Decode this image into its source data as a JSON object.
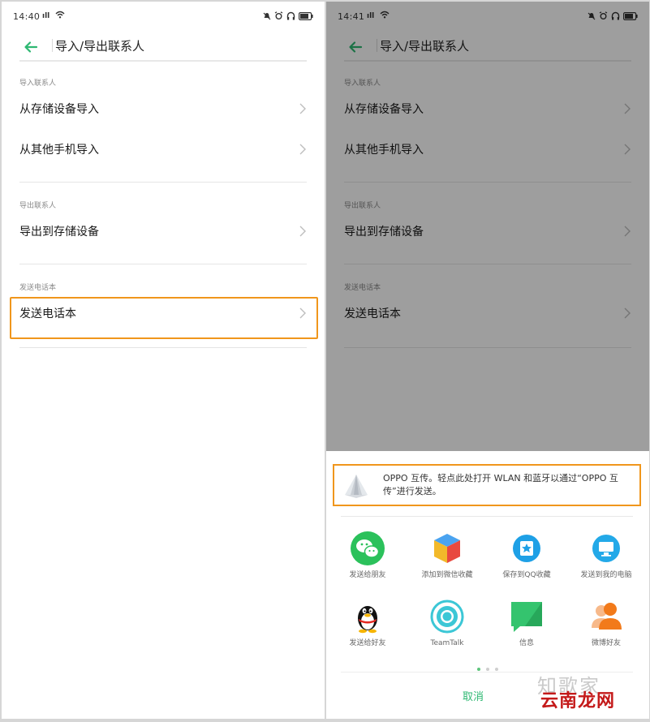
{
  "left_screen": {
    "status": {
      "time": "14:40",
      "signal": "ıll"
    },
    "toolbar": {
      "title": "导入/导出联系人"
    },
    "sections": [
      {
        "header": "导入联系人",
        "items": [
          "从存储设备导入",
          "从其他手机导入"
        ]
      },
      {
        "header": "导出联系人",
        "items": [
          "导出到存储设备"
        ]
      },
      {
        "header": "发送电话本",
        "items": [
          "发送电话本"
        ]
      }
    ]
  },
  "right_screen": {
    "status": {
      "time": "14:41",
      "signal": "ıll"
    },
    "toolbar": {
      "title": "导入/导出联系人"
    },
    "sections": [
      {
        "header": "导入联系人",
        "items": [
          "从存储设备导入",
          "从其他手机导入"
        ]
      },
      {
        "header": "导出联系人",
        "items": [
          "导出到存储设备"
        ]
      },
      {
        "header": "发送电话本",
        "items": [
          "发送电话本"
        ]
      }
    ],
    "share_sheet": {
      "oppo_banner_text": "OPPO 互传。轻点此处打开 WLAN 和蓝牙以通过“OPPO 互传”进行发送。",
      "apps": [
        {
          "label": "发送给朋友",
          "icon": "wechat-icon"
        },
        {
          "label": "添加到微信收藏",
          "icon": "favorites-cube-icon"
        },
        {
          "label": "保存到QQ收藏",
          "icon": "qq-favorites-icon"
        },
        {
          "label": "发送到我的电脑",
          "icon": "computer-icon"
        },
        {
          "label": "发送给好友",
          "icon": "qq-penguin-icon"
        },
        {
          "label": "TeamTalk",
          "icon": "teamtalk-icon"
        },
        {
          "label": "信息",
          "icon": "messages-icon"
        },
        {
          "label": "微博好友",
          "icon": "weibo-friends-icon"
        }
      ],
      "cancel_label": "取消"
    }
  },
  "watermark": {
    "line1": "知歌家",
    "line2": "云南龙网"
  },
  "colors": {
    "accent_green": "#2eb872",
    "highlight_orange": "#f0961c"
  }
}
